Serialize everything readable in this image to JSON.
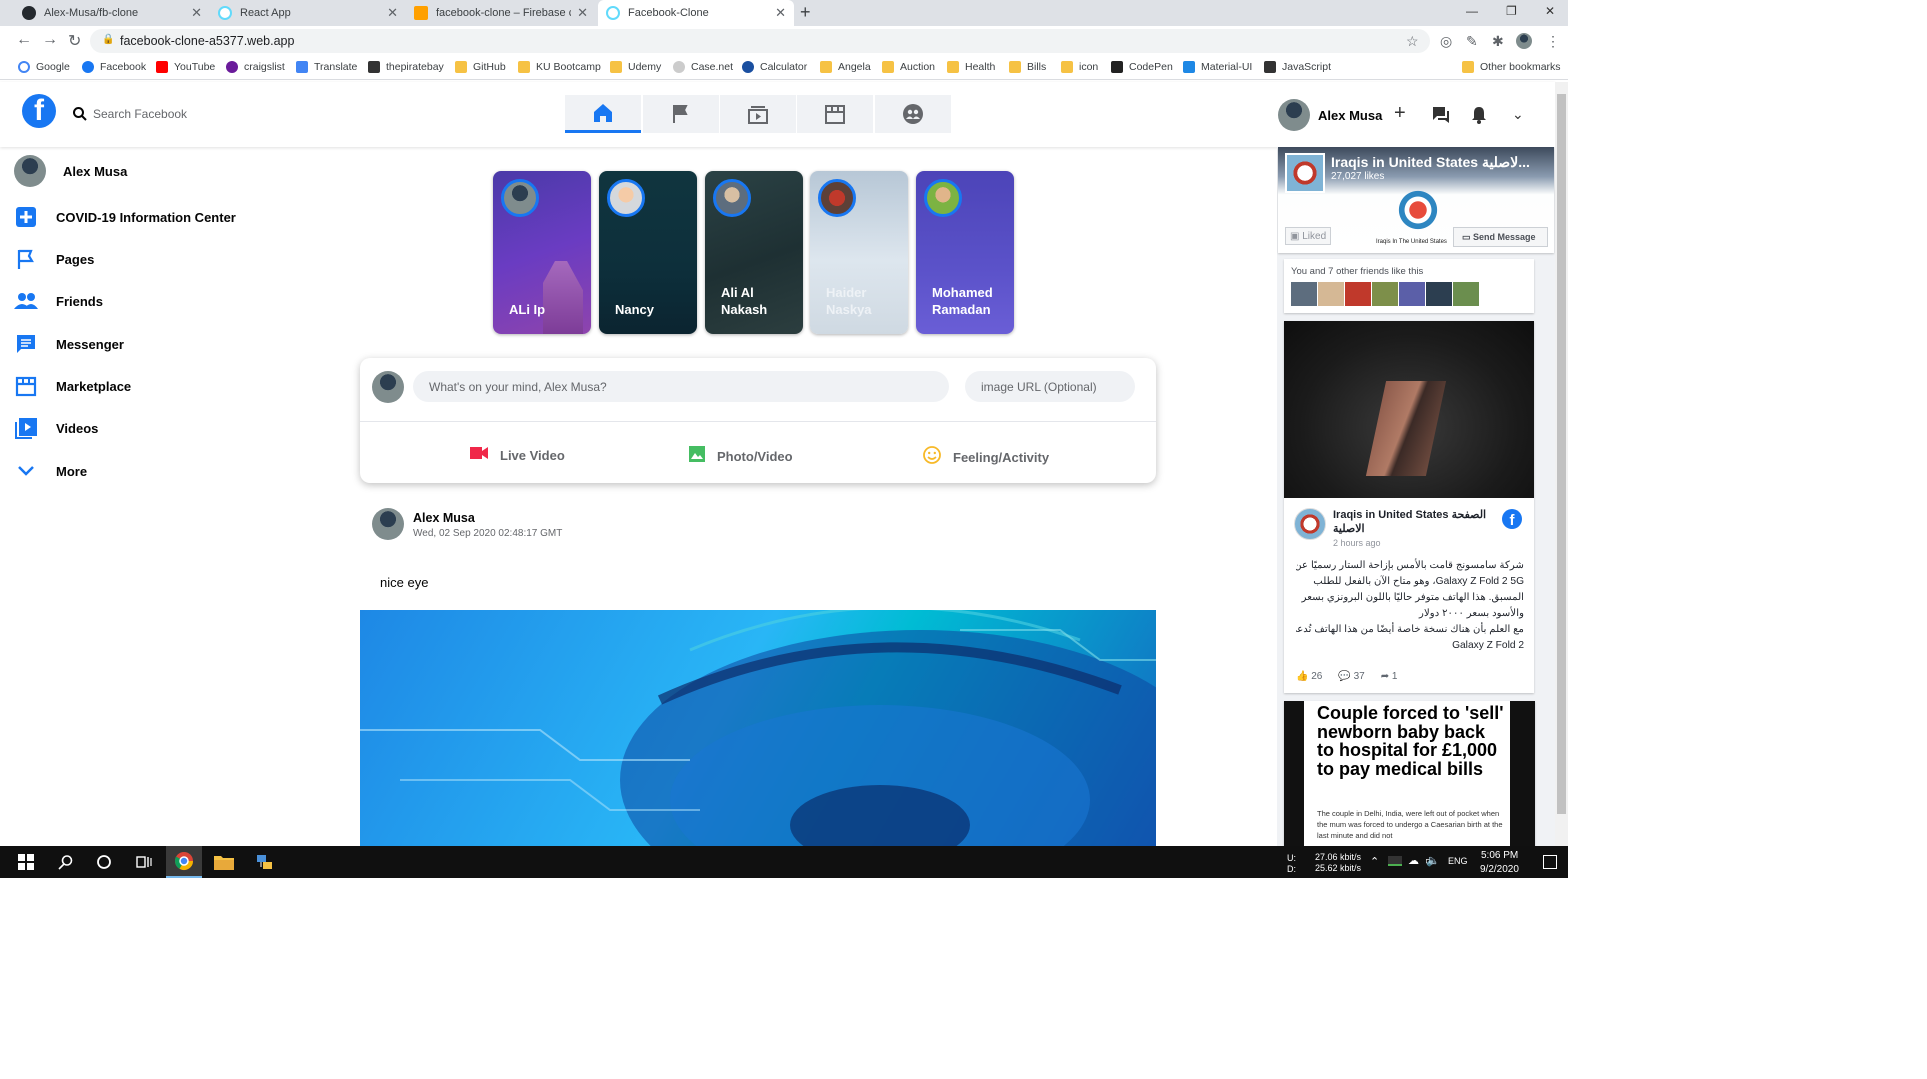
{
  "browser": {
    "tabs": [
      {
        "title": "Alex-Musa/fb-clone",
        "icon": "github-icon"
      },
      {
        "title": "React App",
        "icon": "react-icon"
      },
      {
        "title": "facebook-clone – Firebase conso",
        "icon": "firebase-icon"
      },
      {
        "title": "Facebook-Clone",
        "icon": "react-icon",
        "active": true
      }
    ],
    "url": "facebook-clone-a5377.web.app",
    "bookmarks": [
      "Google",
      "Facebook",
      "YouTube",
      "craigslist",
      "Translate",
      "thepiratebay",
      "GitHub",
      "KU Bootcamp",
      "Udemy",
      "Case.net",
      "Calculator",
      "Angela",
      "Auction",
      "Health",
      "Bills",
      "icon",
      "CodePen",
      "Material-UI",
      "JavaScript"
    ],
    "other_bookmarks": "Other bookmarks"
  },
  "header": {
    "search_placeholder": "Search Facebook",
    "user_name": "Alex Musa"
  },
  "sidebar": {
    "items": [
      {
        "label": "Alex Musa",
        "icon": "avatar"
      },
      {
        "label": "COVID-19 Information Center",
        "icon": "plus-icon"
      },
      {
        "label": "Pages",
        "icon": "flag-icon"
      },
      {
        "label": "Friends",
        "icon": "people-icon"
      },
      {
        "label": "Messenger",
        "icon": "chat-icon"
      },
      {
        "label": "Marketplace",
        "icon": "store-icon"
      },
      {
        "label": "Videos",
        "icon": "video-icon"
      },
      {
        "label": "More",
        "icon": "chevron-down-icon"
      }
    ]
  },
  "stories": [
    {
      "name": "ALi Ip"
    },
    {
      "name": "Nancy"
    },
    {
      "name": "Ali Al Nakash"
    },
    {
      "name": "Haider Naskya"
    },
    {
      "name": "Mohamed Ramadan"
    }
  ],
  "composer": {
    "text_placeholder": "What's on your mind, Alex Musa?",
    "image_placeholder": "image URL (Optional)",
    "actions": [
      "Live Video",
      "Photo/Video",
      "Feeling/Activity"
    ]
  },
  "post": {
    "author": "Alex Musa",
    "timestamp": "Wed, 02 Sep 2020 02:48:17 GMT",
    "text": "nice eye"
  },
  "right_column": {
    "page_title": "Iraqis in United States لاصلية...",
    "page_likes": "27,027 likes",
    "liked_label": "Liked",
    "send_message_label": "Send Message",
    "friends_like": "You and 7 other friends like this",
    "banner_caption": "Iraqis In The United States",
    "post_page": "Iraqis in United States الصفحة الاصلية",
    "post_time": "2 hours ago",
    "post_text_lines": [
      "شركة سامسونج قامت بالأمس بإزاحة الستار رسميًا عن الهاتف",
      "Galaxy Z Fold 2 5G، وهو متاح الآن بالفعل للطلب",
      "المسبق. هذا الهاتف متوفر حاليًا باللون البرونزي بسعر",
      "والأسود بسعر ٢٠٠٠ دولار",
      "مع العلم بأن هناك نسخة خاصة أيضًا من هذا الهاتف تُدعى",
      "Galaxy Z Fold 2"
    ],
    "reactions": {
      "likes": "26",
      "comments": "37",
      "shares": "1"
    },
    "news_headline": "Couple forced to 'sell' newborn baby back to hospital for £1,000 to pay medical bills",
    "news_body": "The couple in Delhi, India, were left out of pocket when the mum was forced to undergo a Caesarian birth at the last minute and did not"
  },
  "taskbar": {
    "net_up": "27.06 kbit/s",
    "net_down": "25.62 kbit/s",
    "net_up_label": "U:",
    "net_down_label": "D:",
    "lang": "ENG",
    "time": "5:06 PM",
    "date": "9/2/2020"
  },
  "colors": {
    "fb_blue": "#1877f2",
    "live_red": "#f02849",
    "photo_green": "#45bd62",
    "feeling_yellow": "#f7b928"
  }
}
